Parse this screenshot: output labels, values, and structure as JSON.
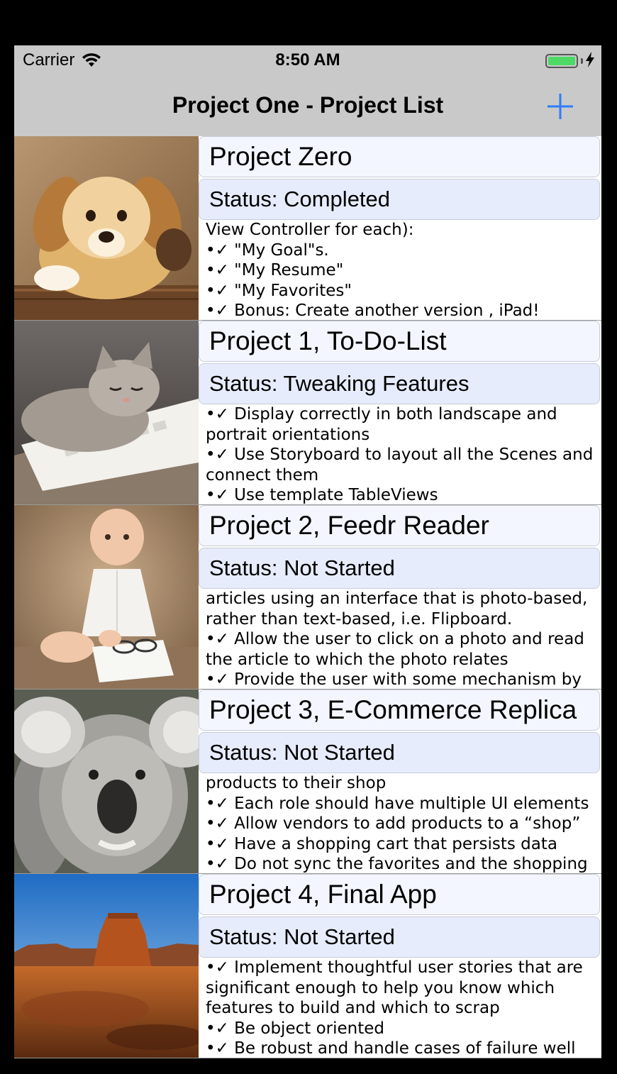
{
  "status_bar": {
    "carrier": "Carrier",
    "time": "8:50 AM",
    "battery_level": 1.0
  },
  "nav": {
    "title": "Project One - Project List",
    "add_icon": "plus-icon",
    "accent_color": "#2f7cf6"
  },
  "projects": [
    {
      "image": "puppy-photo",
      "title": "Project Zero",
      "status": "Status: Completed",
      "lines": [
        "View Controller for each):",
        "•✓ \"My Goal\"s.",
        "•✓ \"My Resume\"",
        "•✓ \"My Favorites\"",
        "•✓ Bonus: Create another version , iPad!"
      ]
    },
    {
      "image": "kitten-on-keyboard-photo",
      "title": "Project 1, To-Do-List",
      "status": "Status: Tweaking Features",
      "lines": [
        "•✓ Display correctly in both landscape and",
        "portrait orientations",
        "•✓ Use Storyboard to layout all the Scenes and",
        "connect them",
        "•✓ Use template TableViews"
      ]
    },
    {
      "image": "baby-photo",
      "title": "Project 2, Feedr Reader",
      "status": "Status: Not Started",
      "lines": [
        "articles using an interface that is photo-based,",
        "rather than text-based, i.e. Flipboard.",
        "•✓ Allow the user to click on a photo and read",
        "the article to which the photo relates",
        "•✓ Provide the user with some mechanism by"
      ]
    },
    {
      "image": "koala-photo",
      "title": "Project 3, E-Commerce Replica",
      "status": "Status: Not Started",
      "lines": [
        "products to their shop",
        "•✓ Each role should have multiple UI elements",
        "•✓ Allow vendors to add products to a “shop”",
        "•✓ Have a shopping cart that persists data",
        "•✓ Do not sync the favorites and the shopping"
      ]
    },
    {
      "image": "desert-mesa-photo",
      "title": "Project 4, Final App",
      "status": "Status: Not Started",
      "lines": [
        "•✓ Implement thoughtful user stories that are",
        "significant enough to help you know which",
        "features to build and which to scrap",
        "•✓ Be object oriented",
        "•✓ Be robust and handle cases of failure well"
      ]
    }
  ]
}
